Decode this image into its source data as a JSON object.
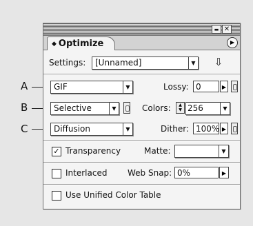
{
  "callouts": {
    "a": "A",
    "b": "B",
    "c": "C"
  },
  "window": {
    "collapse_glyph": "▬",
    "close_glyph": "✕"
  },
  "panel": {
    "tab_arrows": "◆",
    "title": "Optimize",
    "menu_glyph": "▶",
    "settings": {
      "label": "Settings:",
      "value": "[Unnamed]",
      "load_glyph": "⇩"
    },
    "format": {
      "value": "GIF"
    },
    "lossy": {
      "label": "Lossy:",
      "value": "0"
    },
    "palette": {
      "value": "Selective"
    },
    "colors": {
      "label": "Colors:",
      "value": "256"
    },
    "dither_method": {
      "value": "Diffusion"
    },
    "dither": {
      "label": "Dither:",
      "value": "100%"
    },
    "transparency": {
      "label": "Transparency",
      "checked": true,
      "check_glyph": "✓"
    },
    "matte": {
      "label": "Matte:",
      "value": ""
    },
    "interlaced": {
      "label": "Interlaced",
      "checked": false
    },
    "web_snap": {
      "label": "Web Snap:",
      "value": "0%"
    },
    "unified": {
      "label": "Use Unified Color Table",
      "checked": false
    },
    "arrows": {
      "down": "▼",
      "right": "▶",
      "up": "▲"
    }
  }
}
